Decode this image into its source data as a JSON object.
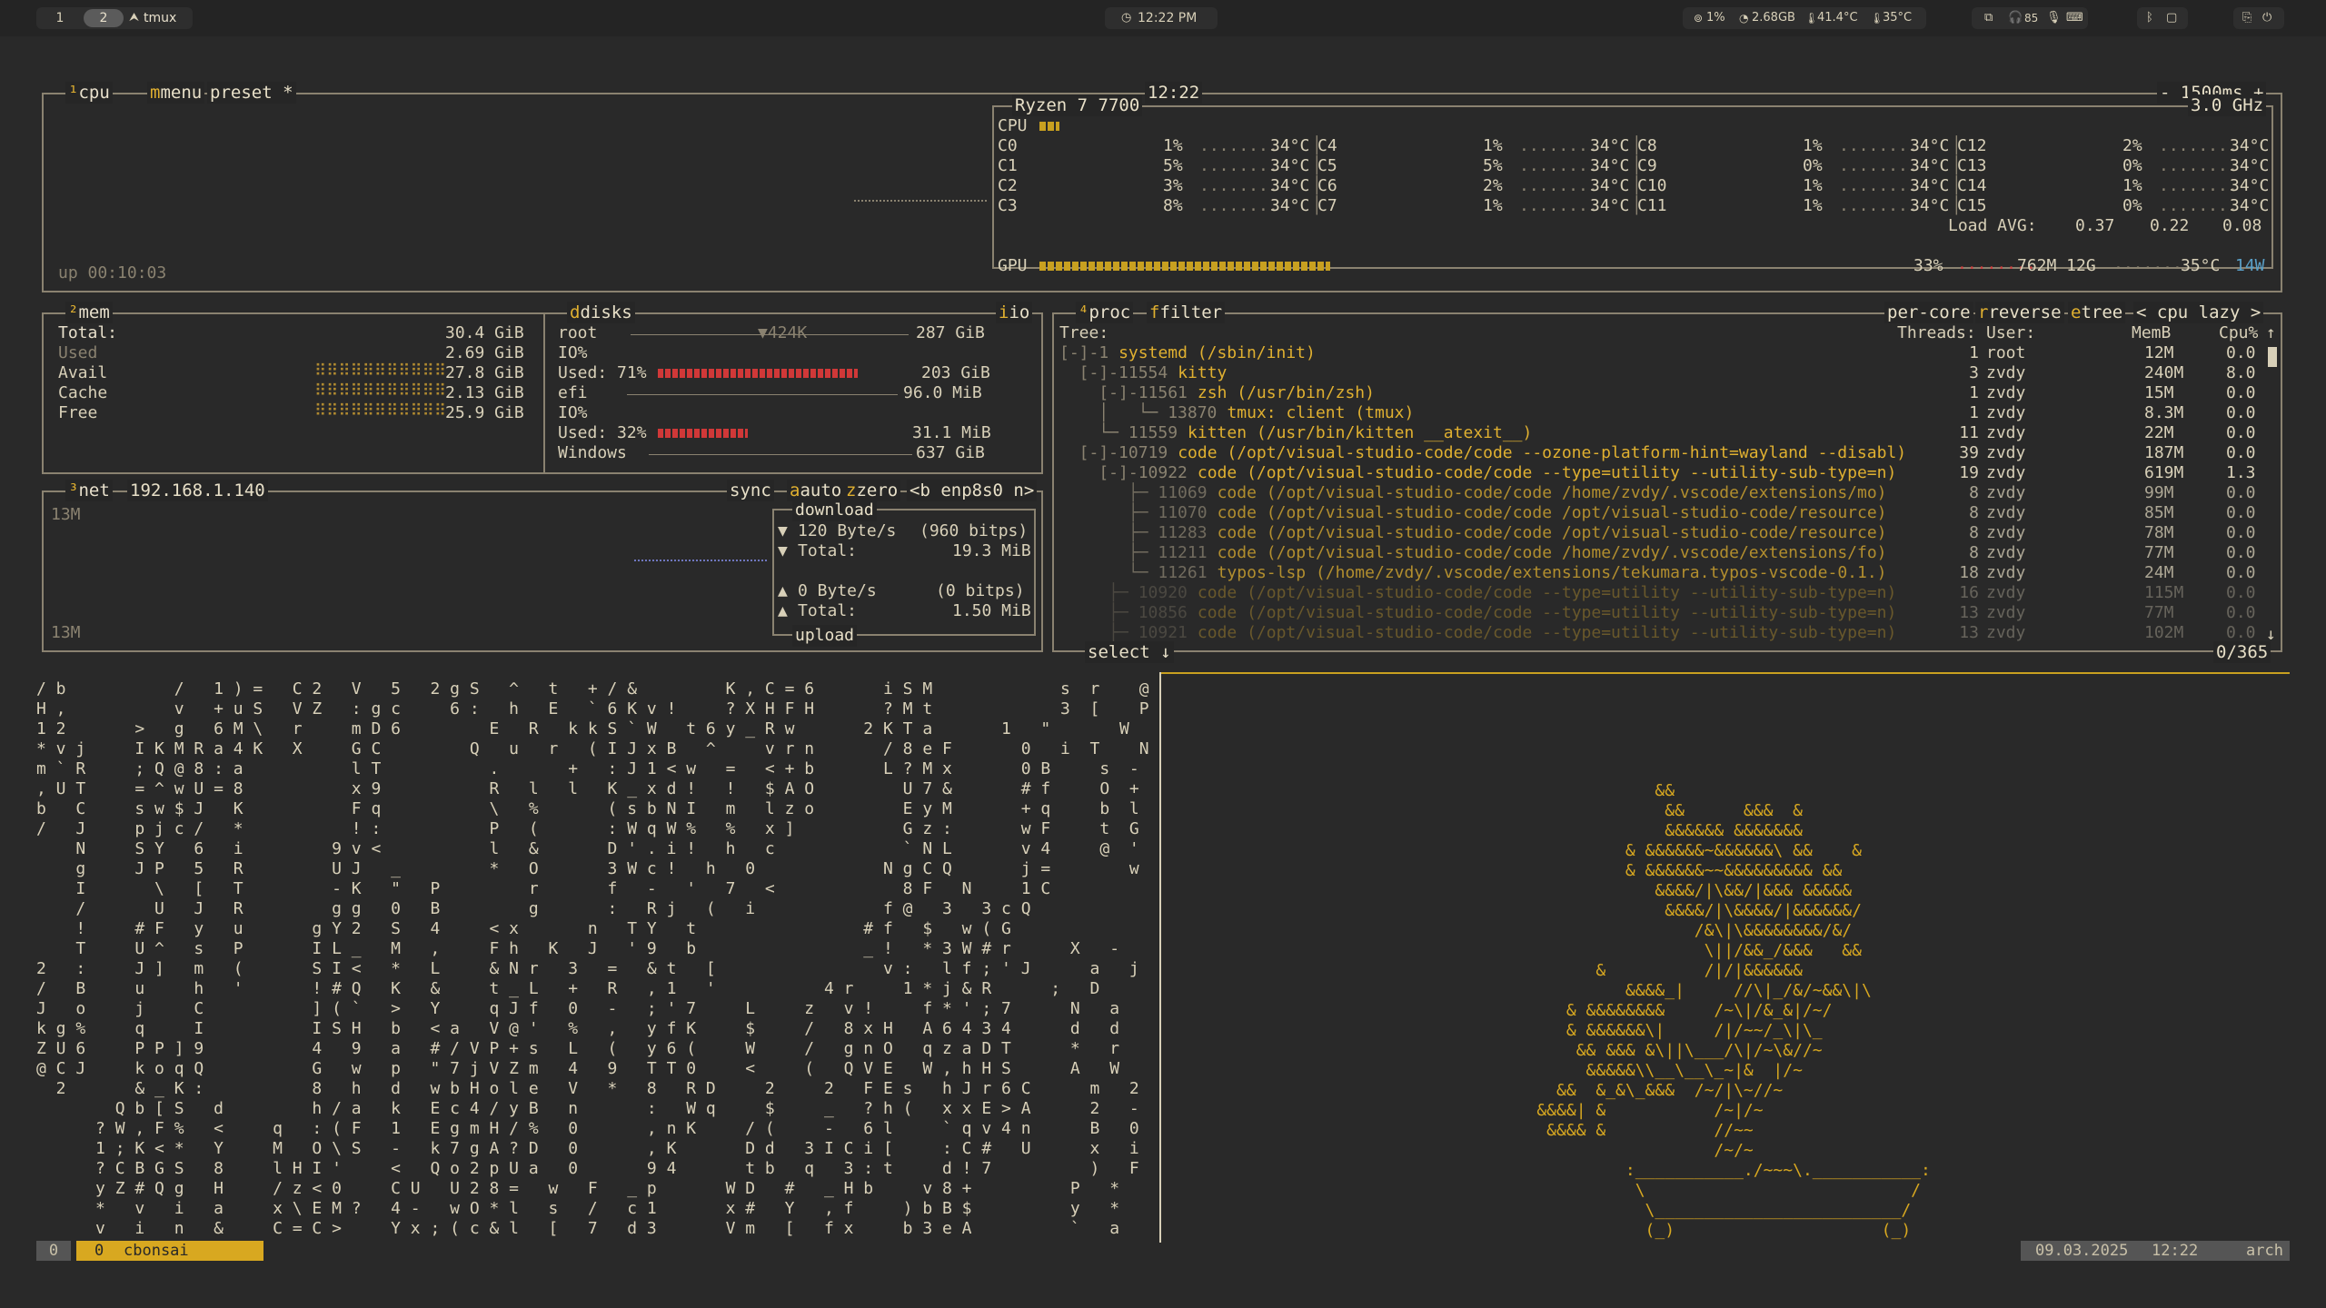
{
  "topbar": {
    "workspaces": [
      "1",
      "2"
    ],
    "active_app_icon": "tmux-arrow-icon",
    "active_app": "tmux",
    "clock": "12:22 PM",
    "sys": {
      "cpu": "1%",
      "mem": "2.68GB",
      "temp1": "41.4°C",
      "temp2": "35°C"
    }
  },
  "cpu": {
    "title": "cpu",
    "menu": "menu",
    "preset": "preset *",
    "clock": "12:22",
    "interval": "- 1500ms +",
    "uptime": "up 00:10:03",
    "model": "Ryzen 7 7700",
    "freq": "3.0 GHz",
    "cpu_label": "CPU",
    "cores": [
      {
        "name": "C0",
        "pct": "1%",
        "temp": "34°C"
      },
      {
        "name": "C1",
        "pct": "5%",
        "temp": "34°C"
      },
      {
        "name": "C2",
        "pct": "3%",
        "temp": "34°C"
      },
      {
        "name": "C3",
        "pct": "8%",
        "temp": "34°C"
      },
      {
        "name": "C4",
        "pct": "1%",
        "temp": "34°C"
      },
      {
        "name": "C5",
        "pct": "5%",
        "temp": "34°C"
      },
      {
        "name": "C6",
        "pct": "2%",
        "temp": "34°C"
      },
      {
        "name": "C7",
        "pct": "1%",
        "temp": "34°C"
      },
      {
        "name": "C8",
        "pct": "1%",
        "temp": "34°C"
      },
      {
        "name": "C9",
        "pct": "0%",
        "temp": "34°C"
      },
      {
        "name": "C10",
        "pct": "1%",
        "temp": "34°C"
      },
      {
        "name": "C11",
        "pct": "1%",
        "temp": "34°C"
      },
      {
        "name": "C12",
        "pct": "2%",
        "temp": "34°C"
      },
      {
        "name": "C13",
        "pct": "0%",
        "temp": "34°C"
      },
      {
        "name": "C14",
        "pct": "1%",
        "temp": "34°C"
      },
      {
        "name": "C15",
        "pct": "0%",
        "temp": "34°C"
      }
    ],
    "load_label": "Load AVG:",
    "load": [
      "0.37",
      "0.22",
      "0.08"
    ],
    "gpu_label": "GPU",
    "gpu_pct": "33%",
    "gpu_mem": "762M 12G",
    "gpu_temp": "35°C",
    "gpu_power": "14W"
  },
  "mem": {
    "title": "mem",
    "rows": [
      {
        "label": "Total:",
        "value": "30.4 GiB"
      },
      {
        "label": "Used",
        "value": "2.69 GiB"
      },
      {
        "label": "Avail",
        "value": "27.8 GiB"
      },
      {
        "label": "Cache",
        "value": "2.13 GiB"
      },
      {
        "label": "Free",
        "value": "25.9 GiB"
      }
    ]
  },
  "disks": {
    "title": "disks",
    "io": "io",
    "root": {
      "name": "root",
      "io_rate": "▼424K",
      "size": "287 GiB",
      "io_label": "IO%",
      "used_label": "Used: 71%",
      "used": "203 GiB",
      "used_fraction": 0.71
    },
    "efi": {
      "name": "efi",
      "size": "96.0 MiB",
      "io_label": "IO%",
      "used_label": "Used: 32%",
      "used": "31.1 MiB",
      "used_fraction": 0.32
    },
    "windows": {
      "name": "Windows",
      "size": "637 GiB"
    }
  },
  "net": {
    "title": "net",
    "ip": "192.168.1.140",
    "sync": "sync",
    "auto": "auto",
    "zero": "zero",
    "iface": "<b enp8s0 n>",
    "scale_top": "13M",
    "scale_bottom": "13M",
    "download_label": "download",
    "down_rate": "120 Byte/s",
    "down_bits": "(960 bitps)",
    "down_total_label": "Total:",
    "down_total": "19.3 MiB",
    "up_rate": "0 Byte/s",
    "up_bits": "(0 bitps)",
    "up_total_label": "Total:",
    "up_total": "1.50 MiB",
    "upload_label": "upload"
  },
  "proc": {
    "title": "proc",
    "filter": "filter",
    "per_core": "per-core",
    "reverse": "reverse",
    "tree": "tree",
    "sort": "< cpu lazy >",
    "cols": {
      "tree": "Tree:",
      "threads": "Threads:",
      "user": "User:",
      "mem": "MemB",
      "cpu": "Cpu%"
    },
    "rows": [
      {
        "tree": "[-]-1 ",
        "cmd": "systemd (/sbin/init)",
        "threads": "1",
        "user": "root",
        "mem": "12M",
        "cpu": "0.0"
      },
      {
        "tree": "  [-]-11554 ",
        "cmd": "kitty",
        "threads": "3",
        "user": "zvdy",
        "mem": "240M",
        "cpu": "8.0"
      },
      {
        "tree": "    [-]-11561 ",
        "cmd": "zsh (/usr/bin/zsh)",
        "threads": "1",
        "user": "zvdy",
        "mem": "15M",
        "cpu": "0.0"
      },
      {
        "tree": "    │   └─ 13870 ",
        "cmd": "tmux: client (tmux)",
        "threads": "1",
        "user": "zvdy",
        "mem": "8.3M",
        "cpu": "0.0"
      },
      {
        "tree": "    └─ 11559 ",
        "cmd": "kitten (/usr/bin/kitten __atexit__)",
        "threads": "11",
        "user": "zvdy",
        "mem": "22M",
        "cpu": "0.0"
      },
      {
        "tree": "  [-]-10719 ",
        "cmd": "code (/opt/visual-studio-code/code --ozone-platform-hint=wayland --disabl)",
        "threads": "39",
        "user": "zvdy",
        "mem": "187M",
        "cpu": "0.0"
      },
      {
        "tree": "    [-]-10922 ",
        "cmd": "code (/opt/visual-studio-code/code --type=utility --utility-sub-type=n)",
        "threads": "19",
        "user": "zvdy",
        "mem": "619M",
        "cpu": "1.3"
      },
      {
        "tree": "       ├─ 11069 ",
        "cmd": "code (/opt/visual-studio-code/code /home/zvdy/.vscode/extensions/mo)",
        "threads": "8",
        "user": "zvdy",
        "mem": "99M",
        "cpu": "0.0"
      },
      {
        "tree": "       ├─ 11070 ",
        "cmd": "code (/opt/visual-studio-code/code /opt/visual-studio-code/resource)",
        "threads": "8",
        "user": "zvdy",
        "mem": "85M",
        "cpu": "0.0"
      },
      {
        "tree": "       ├─ 11283 ",
        "cmd": "code (/opt/visual-studio-code/code /opt/visual-studio-code/resource)",
        "threads": "8",
        "user": "zvdy",
        "mem": "78M",
        "cpu": "0.0"
      },
      {
        "tree": "       ├─ 11211 ",
        "cmd": "code (/opt/visual-studio-code/code /home/zvdy/.vscode/extensions/fo)",
        "threads": "8",
        "user": "zvdy",
        "mem": "77M",
        "cpu": "0.0"
      },
      {
        "tree": "       └─ 11261 ",
        "cmd": "typos-lsp (/home/zvdy/.vscode/extensions/tekumara.typos-vscode-0.1.)",
        "threads": "18",
        "user": "zvdy",
        "mem": "24M",
        "cpu": "0.0"
      },
      {
        "tree": "     ├─ 10920 ",
        "cmd": "code (/opt/visual-studio-code/code --type=utility --utility-sub-type=n)",
        "threads": "16",
        "user": "zvdy",
        "mem": "115M",
        "cpu": "0.0"
      },
      {
        "tree": "     ├─ 10856 ",
        "cmd": "code (/opt/visual-studio-code/code --type=utility --utility-sub-type=n)",
        "threads": "13",
        "user": "zvdy",
        "mem": "77M",
        "cpu": "0.0"
      },
      {
        "tree": "     ├─ 10921 ",
        "cmd": "code (/opt/visual-studio-code/code --type=utility --utility-sub-type=n)",
        "threads": "13",
        "user": "zvdy",
        "mem": "102M",
        "cpu": "0.0"
      }
    ],
    "select": "select ↓",
    "count": "0/365"
  },
  "matrix_lines": [
    "/ b           /   1 ) =   C 2   V   5   2 g S   ^   t   + / &         K , C = 6       i S M             s  r    @",
    "H ,           v   + u S   V Z   : g c     6 :   h   E   ` 6 K v !     ? X H F H       ? M t             3  [    P",
    "1 2       >   g   6 M \\   r     m D 6         E   R   k k S ` W   t 6 y _ R w       2 K T a       1   \"       W",
    "* v j     I K M R a 4 K   X     G C         Q   u   r   ( I J x B   ^     v r n       / 8 e F       0   i  T    N",
    "m ` R     ; Q @ 8 : a           l T           .       +   : J 1 < w   =   < + b       L ? M x       0 B     s  -",
    ", U T     = ^ w U = 8           x 9           R   l   l   K _ x d !   !   $ A O         U 7 &       # f     O  +",
    "b   C     s w $ J   K           F q           \\   %       ( s b N I   m   l z o         E y M       + q     b  l",
    "/   J     p j c /   *           ! :           P   (       : W q W %   %   x ]           G z :       w F     t  G",
    "    N     S Y   6   i         9 v <           l   &       D ' . i !   h   c             ` N L       v 4     @  '",
    "    g     J P   5   R         U J   _         *   O       3 W c !   h   0             N g C Q       j =        w",
    "    I       \\   [   T         - K   \"   P         r       f   -   '   7   <             8 F   N     1 C",
    "    /       U   J   R         g g   0   B         g       :   R j   (   i             f @   3   3 c Q",
    "    !     # F   y   u       g Y 2   S   4     < x       n   T Y   t                 # f   $   w ( G",
    "    T     U ^   s   P       I L _   M   ,     F h   K   J   ' 9   b                 _ !   * 3 W # r      X   -",
    "2   :     J ]   m   (       S I <   *   L     & N r   3   =   & t   [                 v :   l f ; ' J      a   j",
    "/   B     u     h   '       ! # Q   K   &     t _ L   +   R   , 1   '           4 r     1 * j & R      ;   D",
    "J   o     j     C           ] ( `   >   Y     q J f   0   -   ; ' 7     L     z   v !     f * ' ; 7      N   a",
    "k g %     q     I           I S H   b   < a   V @ '   %   ,   y f K     $     /   8 x H   A 6 4 3 4      d   d",
    "Z U 6     P P ] 9           4   9   a   # / V P + s   L   (   y 6 (     W     /   g n O   q z a D T      *   r",
    "@ C J     k o q Q           G   w   p   \" 7 j V Z m   4   9   T T 0     <     (   Q V E   W , h H S      A   W",
    "  2       & _ K :           8   h   d   w b H o l e   V   *   8   R D     2     2   F E s   h J r 6 C      m   2",
    "        Q b [ S   d         h / a   k   E c 4 / y B   n       :   W q     $     _   ? h (   x x E > A      2   -",
    "      ? W , F %   <     q   : ( F   1   E g m H / %   0       , n K     / (     -   6 l     ` q v 4 n      B   0",
    "      1 ; K < *   Y     M   O \\ S   -   k 7 g A ? D   0       , K       D d   3 I C i [     : C #   U      x   i",
    "      ? C B G S   8     l H I '     <   Q o 2 p U a   0       9 4       t b   q   3 : t     d ! 7          )   F",
    "      y Z # Q g   H     / z < 0     C U   U 2 8 =   w   F   _ p       W D   #   _ H b     v 8 +          P   *",
    "      *   v   i   a     x \\ E M ?   4 -   w O * l   s   /   c 1       x #   Y   , f     ) b B $          y   *",
    "      v   i   n   &     C = C >     Y x ; ( c & l   [   7   d 3       V m   [   f x     b 3 e A          `   a"
  ],
  "bonsai_lines": [
    "                &&",
    "                 &&      &&&  &",
    "                 &&&&&& &&&&&&&",
    "             & &&&&&&~&&&&&&\\ &&    &",
    "             & &&&&&&~~&&&&&&&&& &&",
    "                &&&&/|\\&&/|&&& &&&&&",
    "                 &&&&/|\\&&&&/|&&&&&&/",
    "                    /&\\|\\&&&&&&&&/&/",
    "                     \\||/&&_/&&&   &&",
    "          &          /|/|&&&&&&",
    "             &&&&_|     //\\|_/&/~&&\\|\\",
    "       & &&&&&&&&     /~\\|/&_&|/~/",
    "       & &&&&&&\\|     /|/~~/_\\|\\_",
    "        && &&& &\\||\\___/\\|/~\\&//~",
    "         &&&&&\\\\__\\__\\_~|&  |/~",
    "      &&  &_&\\_&&&  /~/|\\~//~",
    "    &&&&| &           /~|/~",
    "     &&&& &           //~~",
    "                      /~/~",
    "             :___________./~~~\\.___________:",
    "              \\                           /",
    "               \\_________________________/",
    "               (_)                     (_)"
  ],
  "status": {
    "session": "0",
    "window": "0",
    "window_name": "cbonsai",
    "date": "09.03.2025",
    "time": "12:22",
    "host": "arch"
  }
}
